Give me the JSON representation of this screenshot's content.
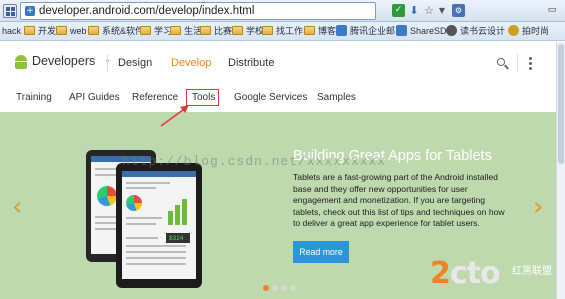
{
  "browser": {
    "url": "developer.android.com/develop/index.html",
    "bookmarks": [
      "hack",
      "开发",
      "web",
      "系统&软件",
      "学习",
      "生活",
      "比赛",
      "学校",
      "找工作",
      "博客",
      "腾讯企业邮",
      "ShareSD",
      "读书云设计",
      "拍时尚"
    ]
  },
  "header": {
    "site_title": "Developers",
    "nav": [
      "Design",
      "Develop",
      "Distribute"
    ],
    "active_nav": "Develop",
    "accent": "#f08226"
  },
  "subnav": {
    "items": [
      "Training",
      "API Guides",
      "Reference",
      "Tools",
      "Google Services",
      "Samples"
    ],
    "highlighted": "Tools",
    "highlight_color": "#e03a3a"
  },
  "hero": {
    "title": "Building Great Apps for Tablets",
    "body": "Tablets are a fast-growing part of the Android installed base and they offer new opportunities for user engagement and monetization. If you are targeting tablets, check out this list of tips and techniques on how to deliver a great app experience for tablet users.",
    "button": "Read more",
    "background": "#bdd9ad",
    "slide_count": 4,
    "active_slide": 1
  },
  "overlay": {
    "watermark_url": "http://blog.csdn.net/xxxxxxxxx",
    "logo_text_main": "2cto",
    "logo_text_cn": "红黑联盟"
  }
}
